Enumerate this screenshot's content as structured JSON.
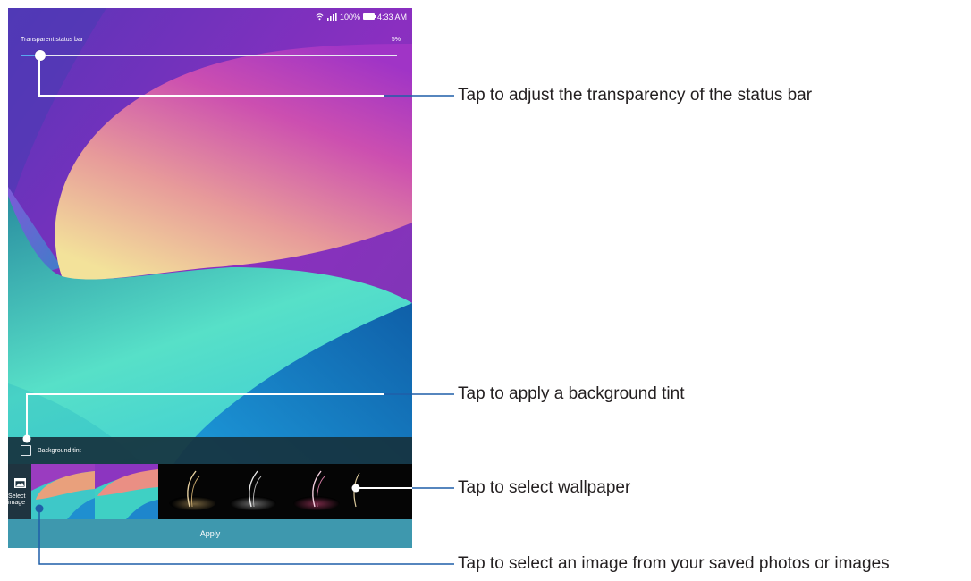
{
  "status_bar": {
    "battery_text": "100%",
    "time": "4:33 AM",
    "icons": [
      "wifi-icon",
      "signal-icon",
      "battery-icon"
    ]
  },
  "transparency": {
    "label": "Transparent status bar",
    "value_text": "5%",
    "level": 0.05
  },
  "background_tint": {
    "label": "Background tint",
    "checked": false
  },
  "wallpaper_picker": {
    "select_image_label": "Select image",
    "select_image_icon": "image-icon",
    "thumbnails": [
      "wallpaper-thumb-1",
      "wallpaper-thumb-2",
      "wallpaper-thumb-3",
      "wallpaper-thumb-4",
      "wallpaper-thumb-5",
      "wallpaper-thumb-6"
    ]
  },
  "apply_label": "Apply",
  "callouts": {
    "transparency": "Tap to adjust the transparency of the status bar",
    "tint": "Tap to apply a background tint",
    "wallpaper": "Tap to select wallpaper",
    "select_image": "Tap to select an image from your saved photos or images"
  },
  "colors": {
    "apply_bar": "#3e98ae",
    "slider_fill": "#5aa8f0",
    "callout_line": "#1f5fa8"
  }
}
